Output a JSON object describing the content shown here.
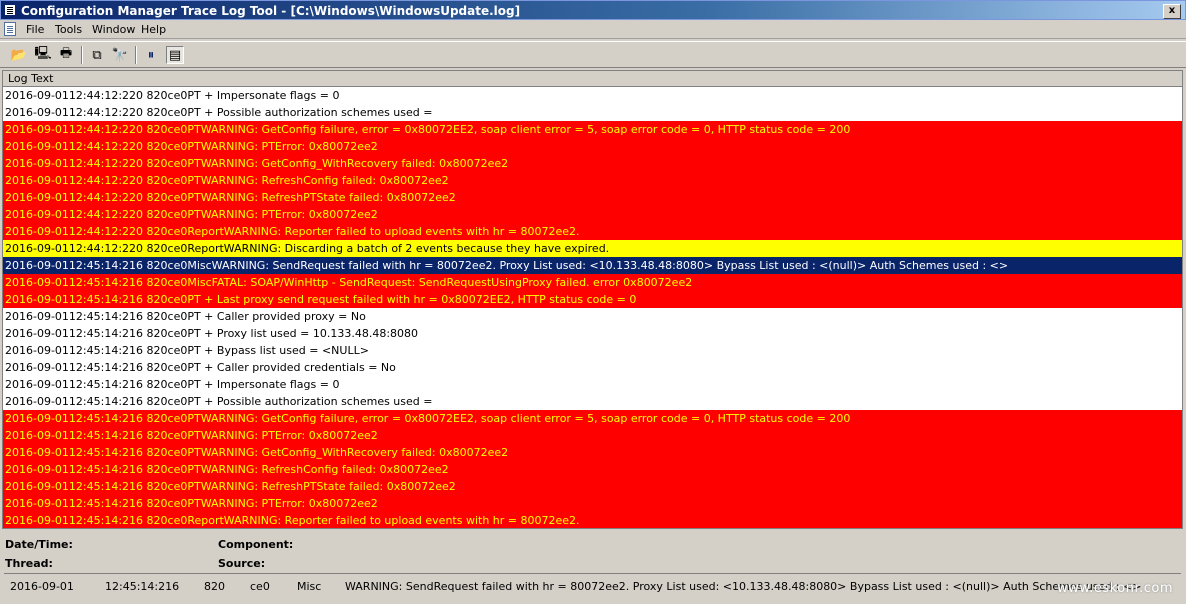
{
  "window": {
    "title": "Configuration Manager Trace Log Tool - [C:\\Windows\\WindowsUpdate.log]",
    "close_symbol": "x"
  },
  "menu": {
    "items": [
      "File",
      "Tools",
      "Window",
      "Help"
    ]
  },
  "toolbar": {
    "icons": [
      "open-folder-icon",
      "print-preview-icon",
      "print-icon",
      "copy-icon",
      "find-icon",
      "pause-icon",
      "highlight-icon"
    ],
    "glyphs": [
      "📂",
      "🖳",
      "🖶",
      "⧉",
      "🔭",
      "⏸",
      "▤"
    ]
  },
  "log": {
    "header": "Log Text",
    "colors": {
      "error_bg": "#ff0000",
      "error_fg": "#ffff00",
      "warning_bg": "#ffff00",
      "selected_bg": "#0a246a"
    },
    "rows": [
      {
        "text": "2016-09-0112:44:12:220 820ce0PT  + Impersonate flags = 0",
        "type": "normal"
      },
      {
        "text": "2016-09-0112:44:12:220 820ce0PT  + Possible authorization schemes used =",
        "type": "normal"
      },
      {
        "text": "2016-09-0112:44:12:220 820ce0PTWARNING: GetConfig failure, error = 0x80072EE2, soap client error = 5, soap error code = 0, HTTP status code = 200",
        "type": "error"
      },
      {
        "text": "2016-09-0112:44:12:220 820ce0PTWARNING: PTError: 0x80072ee2",
        "type": "error"
      },
      {
        "text": "2016-09-0112:44:12:220 820ce0PTWARNING: GetConfig_WithRecovery failed: 0x80072ee2",
        "type": "error"
      },
      {
        "text": "2016-09-0112:44:12:220 820ce0PTWARNING: RefreshConfig failed: 0x80072ee2",
        "type": "error"
      },
      {
        "text": "2016-09-0112:44:12:220 820ce0PTWARNING: RefreshPTState failed: 0x80072ee2",
        "type": "error"
      },
      {
        "text": "2016-09-0112:44:12:220 820ce0PTWARNING: PTError: 0x80072ee2",
        "type": "error"
      },
      {
        "text": "2016-09-0112:44:12:220 820ce0ReportWARNING: Reporter failed to upload events with hr = 80072ee2.",
        "type": "error"
      },
      {
        "text": "2016-09-0112:44:12:220 820ce0ReportWARNING: Discarding a batch of 2 events because they have expired.",
        "type": "warning"
      },
      {
        "text": "2016-09-0112:45:14:216 820ce0MiscWARNING: SendRequest failed with hr = 80072ee2. Proxy List used: <10.133.48.48:8080> Bypass List used : <(null)> Auth Schemes used : <>",
        "type": "selected"
      },
      {
        "text": "2016-09-0112:45:14:216 820ce0MiscFATAL: SOAP/WinHttp - SendRequest: SendRequestUsingProxy failed. error 0x80072ee2",
        "type": "error"
      },
      {
        "text": "2016-09-0112:45:14:216 820ce0PT  + Last proxy send request failed with hr = 0x80072EE2, HTTP status code = 0",
        "type": "error"
      },
      {
        "text": "2016-09-0112:45:14:216 820ce0PT  + Caller provided proxy = No",
        "type": "normal"
      },
      {
        "text": "2016-09-0112:45:14:216 820ce0PT  + Proxy list used = 10.133.48.48:8080",
        "type": "normal"
      },
      {
        "text": "2016-09-0112:45:14:216 820ce0PT  + Bypass list used = <NULL>",
        "type": "normal"
      },
      {
        "text": "2016-09-0112:45:14:216 820ce0PT  + Caller provided credentials = No",
        "type": "normal"
      },
      {
        "text": "2016-09-0112:45:14:216 820ce0PT  + Impersonate flags = 0",
        "type": "normal"
      },
      {
        "text": "2016-09-0112:45:14:216 820ce0PT  + Possible authorization schemes used =",
        "type": "normal"
      },
      {
        "text": "2016-09-0112:45:14:216 820ce0PTWARNING: GetConfig failure, error = 0x80072EE2, soap client error = 5, soap error code = 0, HTTP status code = 200",
        "type": "error"
      },
      {
        "text": "2016-09-0112:45:14:216 820ce0PTWARNING: PTError: 0x80072ee2",
        "type": "error"
      },
      {
        "text": "2016-09-0112:45:14:216 820ce0PTWARNING: GetConfig_WithRecovery failed: 0x80072ee2",
        "type": "error"
      },
      {
        "text": "2016-09-0112:45:14:216 820ce0PTWARNING: RefreshConfig failed: 0x80072ee2",
        "type": "error"
      },
      {
        "text": "2016-09-0112:45:14:216 820ce0PTWARNING: RefreshPTState failed: 0x80072ee2",
        "type": "error"
      },
      {
        "text": "2016-09-0112:45:14:216 820ce0PTWARNING: PTError: 0x80072ee2",
        "type": "error"
      },
      {
        "text": "2016-09-0112:45:14:216 820ce0ReportWARNING: Reporter failed to upload events with hr = 80072ee2.",
        "type": "error"
      }
    ]
  },
  "details": {
    "labels": {
      "datetime": "Date/Time:",
      "component": "Component:",
      "thread": "Thread:",
      "source": "Source:"
    },
    "selected": {
      "date": "2016-09-01",
      "time": "12:45:14:216",
      "pid": "820",
      "thread": "ce0",
      "component": "Misc",
      "message": "WARNING: SendRequest failed with hr = 80072ee2. Proxy List used: <10.133.48.48:8080> Bypass List used : <(null)> Auth Schemes used : <>"
    }
  },
  "watermark": "www.eskonr.com"
}
